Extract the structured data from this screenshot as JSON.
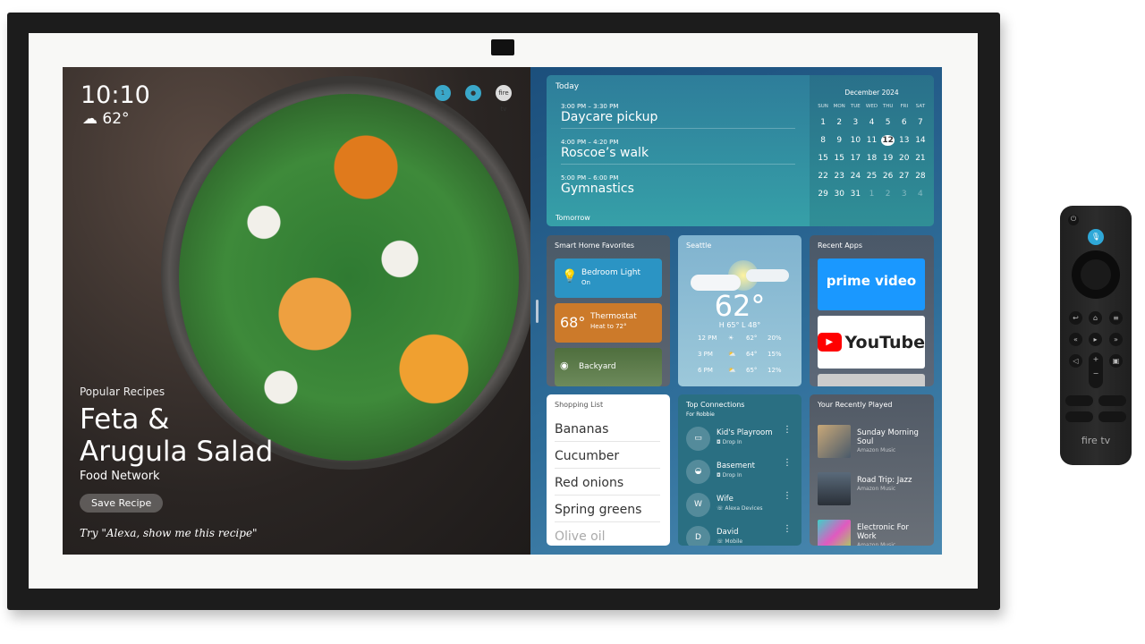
{
  "photo": {
    "time": "10:10",
    "temp": "62°",
    "weather_icon": "cloud-icon",
    "top_icons": [
      "notification-icon",
      "profile-icon",
      "firetv-icon"
    ],
    "notification_count": "1",
    "firetv_label": "fire tv"
  },
  "recipe": {
    "category": "Popular Recipes",
    "title_line1": "Feta &",
    "title_line2": "Arugula Salad",
    "source": "Food Network",
    "save_label": "Save Recipe",
    "hint": "Try \"Alexa, show me this recipe\""
  },
  "today": {
    "label": "Today",
    "events": [
      {
        "time": "3:00 PM – 3:30 PM",
        "name": "Daycare pickup"
      },
      {
        "time": "4:00 PM – 4:20 PM",
        "name": "Roscoe’s walk"
      },
      {
        "time": "5:00 PM – 6:00 PM",
        "name": "Gymnastics"
      }
    ],
    "tomorrow": "Tomorrow"
  },
  "calendar": {
    "month": "December 2024",
    "weekdays": [
      "SUN",
      "MON",
      "TUE",
      "WED",
      "THU",
      "FRI",
      "SAT"
    ],
    "days": [
      "1",
      "2",
      "3",
      "4",
      "5",
      "6",
      "7",
      "8",
      "9",
      "10",
      "11",
      "12",
      "13",
      "14",
      "15",
      "15",
      "17",
      "18",
      "19",
      "20",
      "21",
      "22",
      "23",
      "24",
      "25",
      "26",
      "27",
      "28",
      "29",
      "30",
      "31",
      "1",
      "2",
      "3",
      "4"
    ],
    "selected": "12"
  },
  "smart_home": {
    "title": "Smart Home Favorites",
    "light": {
      "name": "Bedroom Light",
      "state": "On"
    },
    "thermostat": {
      "temp": "68°",
      "name": "Thermostat",
      "state": "Heat to 72°"
    },
    "camera": {
      "name": "Backyard"
    }
  },
  "weather": {
    "city": "Seattle",
    "temp": "62°",
    "hilo": "H 65°  L 48°",
    "forecast": [
      {
        "time": "12 PM",
        "temp": "62°",
        "precip": "20%",
        "icon": "sun-icon"
      },
      {
        "time": "3 PM",
        "temp": "64°",
        "precip": "15%",
        "icon": "partly-cloudy-icon"
      },
      {
        "time": "6 PM",
        "temp": "65°",
        "precip": "12%",
        "icon": "partly-cloudy-icon"
      }
    ]
  },
  "recent_apps": {
    "title": "Recent Apps",
    "apps": [
      "prime video",
      "YouTube"
    ]
  },
  "shopping": {
    "title": "Shopping List",
    "items": [
      "Bananas",
      "Cucumber",
      "Red onions",
      "Spring greens",
      "Olive oil"
    ]
  },
  "connections": {
    "title": "Top Connections",
    "subtitle": "For Robbie",
    "items": [
      {
        "name": "Kid's Playroom",
        "status": "Drop In",
        "avatar": ""
      },
      {
        "name": "Basement",
        "status": "Drop In",
        "avatar": ""
      },
      {
        "name": "Wife",
        "status": "Alexa Devices",
        "avatar": "W"
      },
      {
        "name": "David",
        "status": "Mobile",
        "avatar": "D"
      }
    ]
  },
  "music": {
    "title": "Your Recently Played",
    "items": [
      {
        "name": "Sunday Morning Soul",
        "source": "Amazon Music"
      },
      {
        "name": "Road Trip: Jazz",
        "source": "Amazon Music"
      },
      {
        "name": "Electronic For Work",
        "source": "Amazon Music"
      }
    ]
  },
  "remote": {
    "brand": "fire tv",
    "accent": "#2fa8d8"
  }
}
